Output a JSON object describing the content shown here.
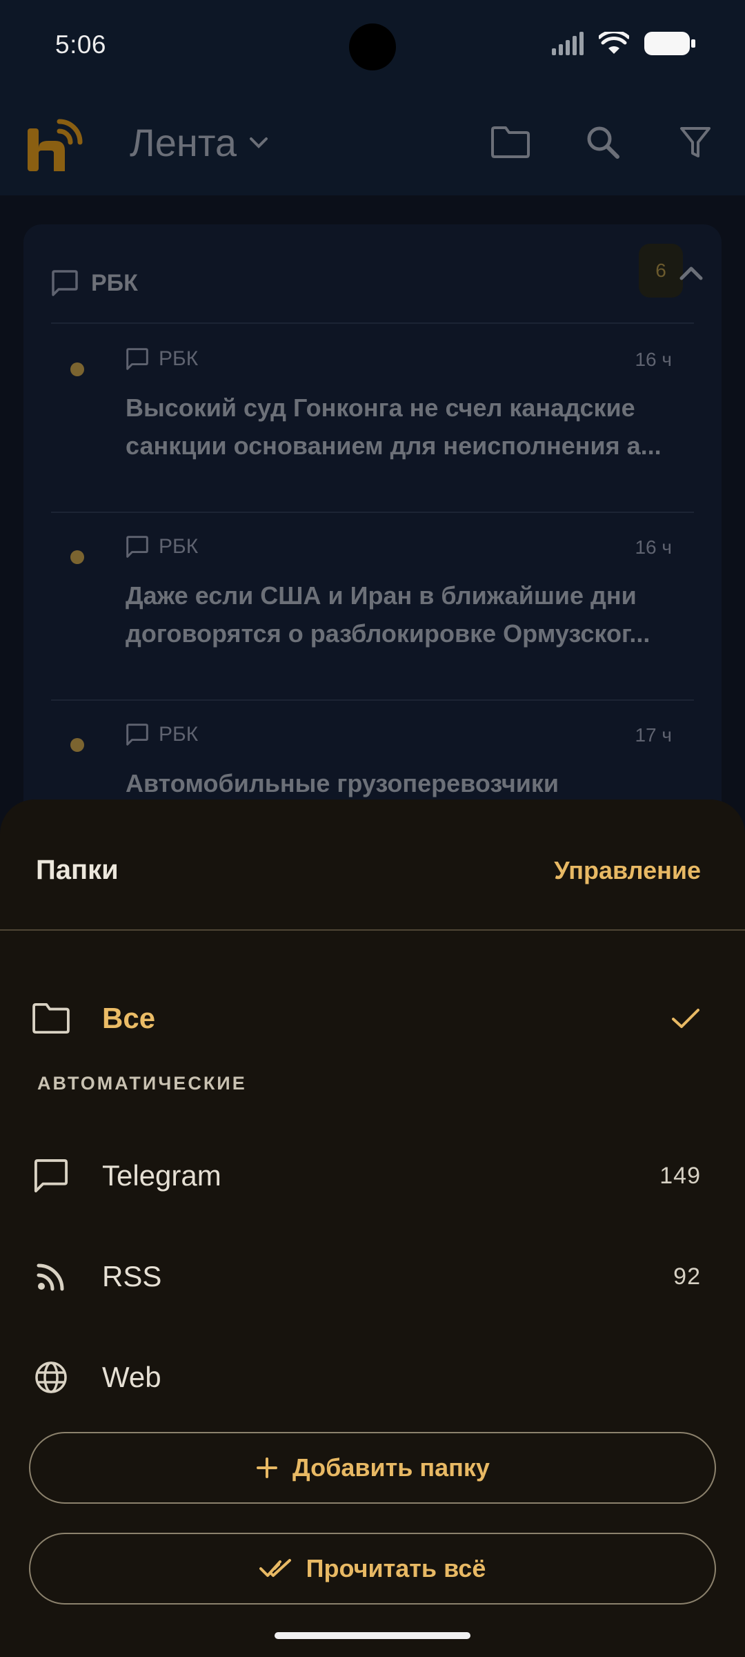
{
  "status": {
    "time": "5:06"
  },
  "appbar": {
    "title": "Лента",
    "icons": [
      "app-logo",
      "chevron-down-icon",
      "folder-icon",
      "search-icon",
      "filter-icon"
    ]
  },
  "group": {
    "title": "РБК",
    "count": "6",
    "items": [
      {
        "source": "РБК",
        "ago": "16 ч",
        "line1": "Высокий суд Гонконга не счел канадские",
        "line2": "санкции основанием для неисполнения а..."
      },
      {
        "source": "РБК",
        "ago": "16 ч",
        "line1": "Даже если США и Иран в ближайшие дни",
        "line2": "договорятся о разблокировке Ормузског..."
      },
      {
        "source": "РБК",
        "ago": "17 ч",
        "line1": "Автомобильные грузоперевозчики",
        "line2": ""
      }
    ]
  },
  "sheet": {
    "title": "Папки",
    "manage": "Управление",
    "all_label": "Все",
    "section_caption": "АВТОМАТИЧЕСКИЕ",
    "folders": [
      {
        "label": "Telegram",
        "count": "149",
        "icon": "chat-icon"
      },
      {
        "label": "RSS",
        "count": "92",
        "icon": "rss-icon"
      },
      {
        "label": "Web",
        "count": "",
        "icon": "globe-icon"
      }
    ],
    "add_folder": "Добавить папку",
    "read_all": "Прочитать всё"
  },
  "colors": {
    "accent": "#e8b964",
    "sheet_bg": "#17130d",
    "screen_bg": "#0b0f19"
  }
}
